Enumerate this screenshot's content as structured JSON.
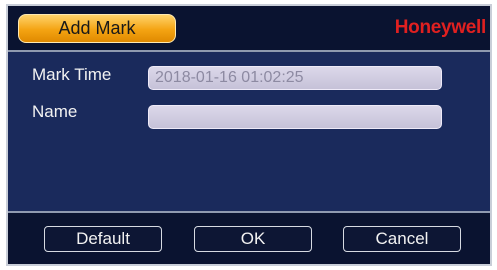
{
  "dialog": {
    "title": "Add Mark",
    "brand": "Honeywell"
  },
  "form": {
    "mark_time_label": "Mark Time",
    "mark_time_value": "2018-01-16 01:02:25",
    "name_label": "Name",
    "name_value": ""
  },
  "buttons": {
    "default": "Default",
    "ok": "OK",
    "cancel": "Cancel"
  },
  "colors": {
    "title_tab": "#f4a312",
    "brand": "#e02020",
    "panel": "#1a2a5c"
  }
}
